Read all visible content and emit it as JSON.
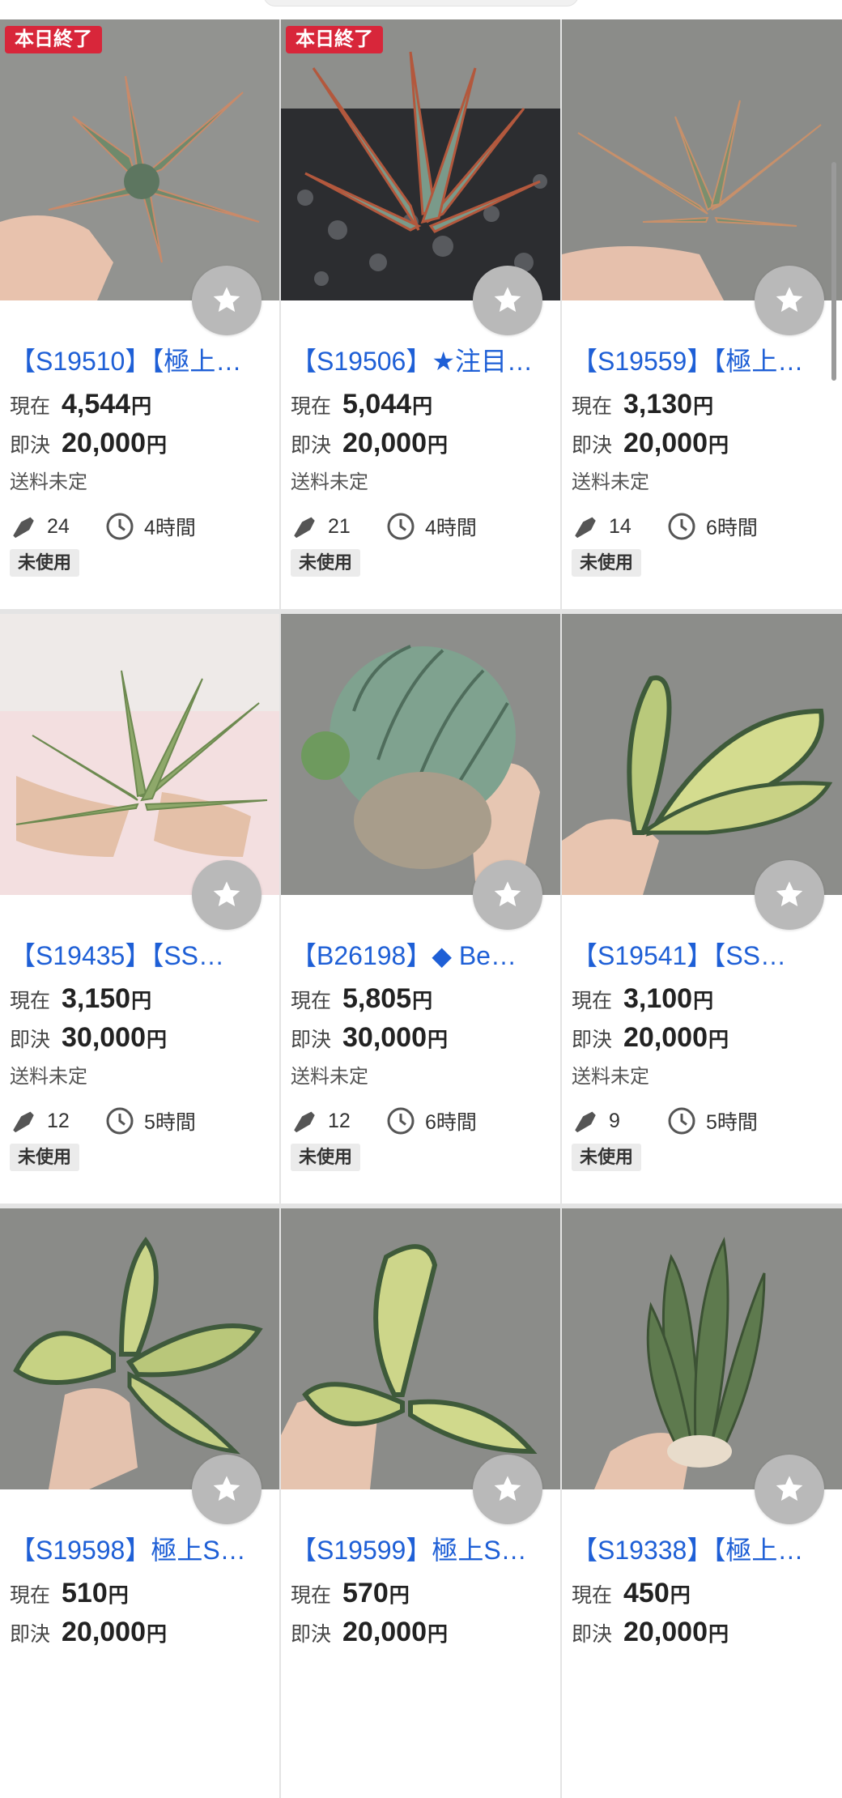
{
  "labels": {
    "current": "現在",
    "buynow": "即決",
    "yen": "円",
    "shipping": "送料未定",
    "ending_today": "本日終了",
    "condition_unused": "未使用"
  },
  "items": [
    {
      "title": "【S19510】【極上…",
      "current": "4,544",
      "buynow": "20,000",
      "bids": "24",
      "time": "4時間",
      "badge": "本日終了",
      "condition": "未使用",
      "photo_icon": "sansevieria-rosette-photo"
    },
    {
      "title": "【S19506】★注目…",
      "current": "5,044",
      "buynow": "20,000",
      "bids": "21",
      "time": "4時間",
      "badge": "本日終了",
      "condition": "未使用",
      "photo_icon": "potted-agave-photo"
    },
    {
      "title": "【S19559】【極上…",
      "current": "3,130",
      "buynow": "20,000",
      "bids": "14",
      "time": "6時間",
      "badge": "",
      "condition": "未使用",
      "photo_icon": "sansevieria-rosette-photo"
    },
    {
      "title": "【S19435】【SS…",
      "current": "3,150",
      "buynow": "30,000",
      "bids": "12",
      "time": "5時間",
      "badge": "",
      "condition": "未使用",
      "photo_icon": "spiky-succulent-photo"
    },
    {
      "title": "【B26198】◆ Be…",
      "current": "5,805",
      "buynow": "30,000",
      "bids": "12",
      "time": "6時間",
      "badge": "",
      "condition": "未使用",
      "photo_icon": "ribbed-cactus-photo"
    },
    {
      "title": "【S19541】【SS…",
      "current": "3,100",
      "buynow": "20,000",
      "bids": "9",
      "time": "5時間",
      "badge": "",
      "condition": "未使用",
      "photo_icon": "variegated-leaf-photo"
    },
    {
      "title": "【S19598】極上S…",
      "current": "510",
      "buynow": "20,000",
      "bids": "",
      "time": "",
      "badge": "",
      "condition": "",
      "photo_icon": "variegated-leaf-photo"
    },
    {
      "title": "【S19599】極上S…",
      "current": "570",
      "buynow": "20,000",
      "bids": "",
      "time": "",
      "badge": "",
      "condition": "",
      "photo_icon": "variegated-leaf-photo"
    },
    {
      "title": "【S19338】【極上…",
      "current": "450",
      "buynow": "20,000",
      "bids": "",
      "time": "",
      "badge": "",
      "condition": "",
      "photo_icon": "upright-sansevieria-photo"
    }
  ],
  "colors": {
    "accent_blue": "#1e5fd6",
    "badge_red": "#d8263a",
    "fav_gray": "#b9b9b9"
  }
}
